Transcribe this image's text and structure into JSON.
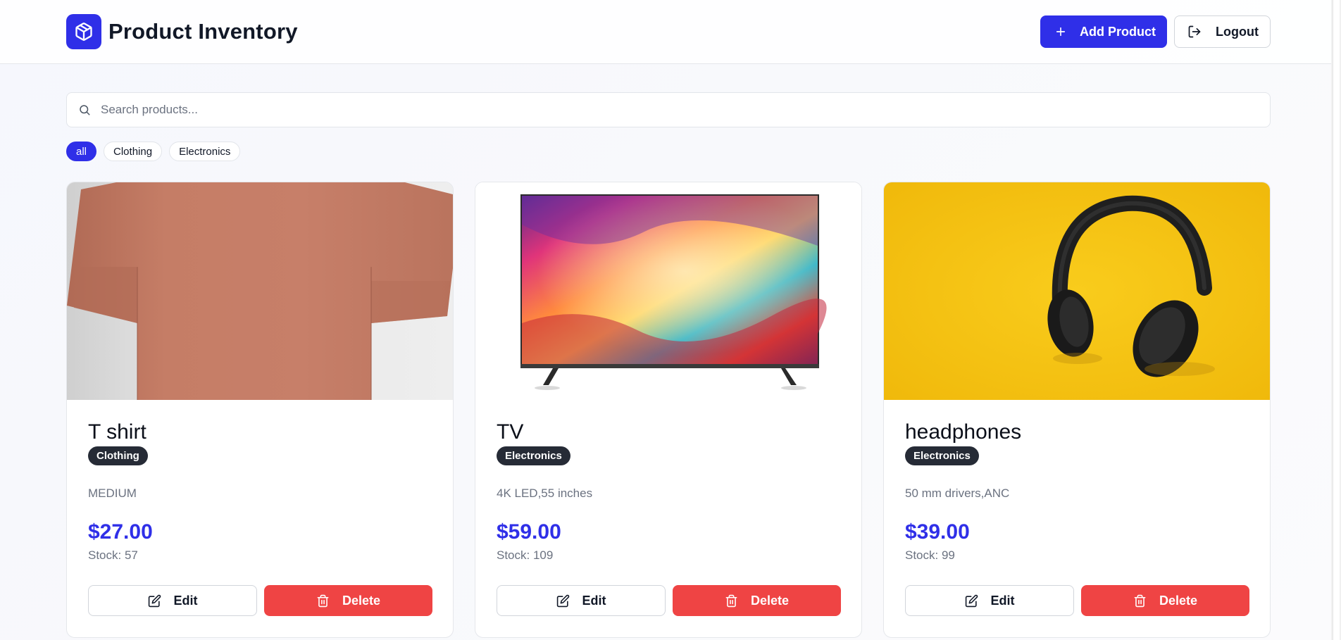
{
  "header": {
    "title": "Product Inventory",
    "logo_icon": "package-icon",
    "add_label": "Add Product",
    "logout_label": "Logout"
  },
  "search": {
    "placeholder": "Search products...",
    "value": ""
  },
  "filters": [
    {
      "label": "all",
      "active": true
    },
    {
      "label": "Clothing",
      "active": false
    },
    {
      "label": "Electronics",
      "active": false
    }
  ],
  "products": [
    {
      "name": "T shirt",
      "category": "Clothing",
      "description": "MEDIUM",
      "price": "$27.00",
      "stock": "Stock: 57",
      "image": "terracotta-tshirt",
      "edit_label": "Edit",
      "delete_label": "Delete"
    },
    {
      "name": "TV",
      "category": "Electronics",
      "description": "4K LED,55 inches",
      "price": "$59.00",
      "stock": "Stock: 109",
      "image": "flat-screen-tv",
      "edit_label": "Edit",
      "delete_label": "Delete"
    },
    {
      "name": "headphones",
      "category": "Electronics",
      "description": "50 mm drivers,ANC",
      "price": "$39.00",
      "stock": "Stock: 99",
      "image": "black-headphones-yellow-bg",
      "edit_label": "Edit",
      "delete_label": "Delete"
    }
  ],
  "colors": {
    "primary": "#2f2fe8",
    "danger": "#ef4444",
    "badge": "#262b36",
    "muted": "#6b7280"
  }
}
